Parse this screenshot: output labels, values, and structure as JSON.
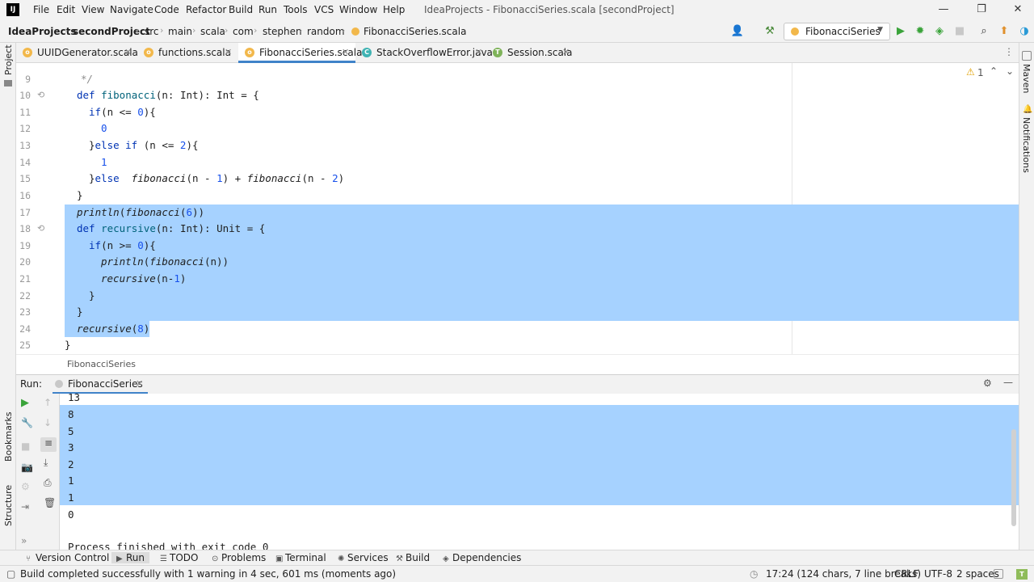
{
  "menubar": {
    "items": [
      "File",
      "Edit",
      "View",
      "Navigate",
      "Code",
      "Refactor",
      "Build",
      "Run",
      "Tools",
      "VCS",
      "Window",
      "Help"
    ],
    "title": "IdeaProjects - FibonacciSeries.scala [secondProject]"
  },
  "breadcrumbs": [
    "IdeaProjects",
    "secondProject",
    "src",
    "main",
    "scala",
    "com",
    "stephen",
    "random",
    "FibonacciSeries.scala"
  ],
  "run_config": "FibonacciSeries",
  "tabs": [
    "UUIDGenerator.scala",
    "functions.scala",
    "FibonacciSeries.scala",
    "StackOverflowError.java",
    "Session.scala"
  ],
  "warnings": "1",
  "left_strip": [
    "Project",
    "Bookmarks",
    "Structure"
  ],
  "right_strip": [
    "Maven",
    "Notifications"
  ],
  "editor": {
    "line_numbers": [
      "9",
      "10",
      "11",
      "12",
      "13",
      "14",
      "15",
      "16",
      "17",
      "18",
      "19",
      "20",
      "21",
      "22",
      "23",
      "24",
      "25"
    ],
    "breadcrumb": "FibonacciSeries"
  },
  "run_panel": {
    "label": "Run:",
    "tab": "FibonacciSeries",
    "output": [
      "13",
      "8",
      "5",
      "3",
      "2",
      "1",
      "1",
      "0"
    ],
    "finished": "Process finished with exit code 0"
  },
  "bottom_tools": [
    "Version Control",
    "Run",
    "TODO",
    "Problems",
    "Terminal",
    "Services",
    "Build",
    "Dependencies"
  ],
  "status": {
    "message": "Build completed successfully with 1 warning in 4 sec, 601 ms (moments ago)",
    "position": "17:24 (124 chars, 7 line breaks)",
    "line_sep": "CRLF",
    "encoding": "UTF-8",
    "indent": "2 spaces"
  },
  "colors": {
    "selection": "#a6d2ff",
    "keyword": "#0033b3",
    "accent": "#4083c9"
  }
}
